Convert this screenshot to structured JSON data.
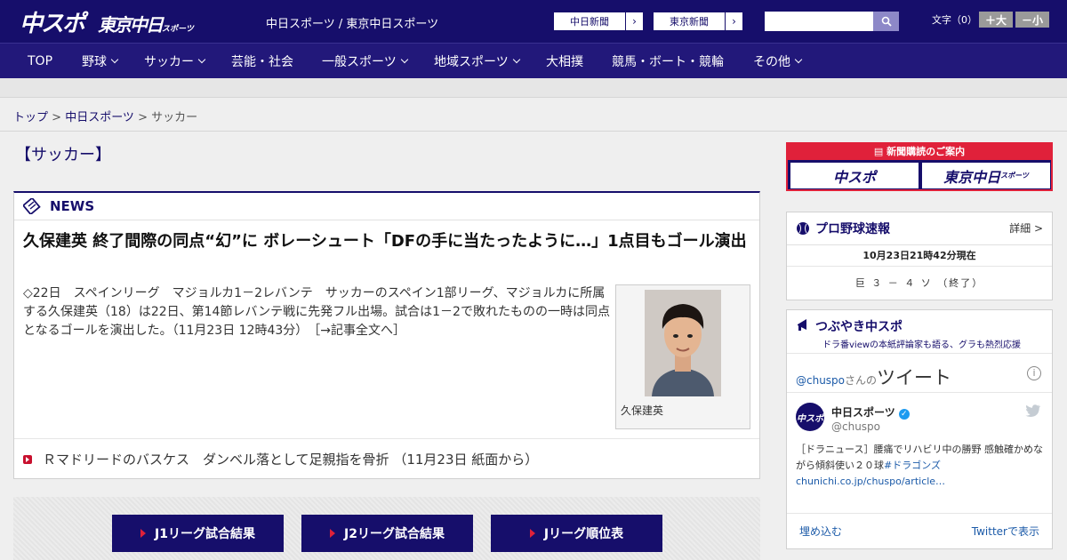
{
  "header": {
    "logo_main": "中スポ",
    "logo_sub": "東京中日",
    "logo_sub_small": "スポーツ",
    "site_title": "中日スポーツ / 東京中日スポーツ",
    "links": [
      {
        "label": "中日新聞",
        "arrow": "›"
      },
      {
        "label": "東京新聞",
        "arrow": "›"
      }
    ],
    "search": {
      "value": "",
      "placeholder": ""
    },
    "font_size_label": "文字（0）",
    "font_up": "＋大",
    "font_down": "－小"
  },
  "nav": {
    "items": [
      {
        "label": "TOP",
        "dropdown": false
      },
      {
        "label": "野球",
        "dropdown": true
      },
      {
        "label": "サッカー",
        "dropdown": true
      },
      {
        "label": "芸能・社会",
        "dropdown": false
      },
      {
        "label": "一般スポーツ",
        "dropdown": true
      },
      {
        "label": "地域スポーツ",
        "dropdown": true
      },
      {
        "label": "大相撲",
        "dropdown": false
      },
      {
        "label": "競馬・ボート・競輪",
        "dropdown": false
      },
      {
        "label": "その他",
        "dropdown": true
      }
    ]
  },
  "breadcrumb": {
    "home": "トップ",
    "sep": " > ",
    "level1": "中日スポーツ",
    "current": "サッカー"
  },
  "section_title": "【サッカー】",
  "news": {
    "label": "NEWS",
    "title": "久保建英 終了間際の同点“幻”に ボレーシュート「DFの手に当たったように…」1点目もゴール演出",
    "body": "◇22日　スペインリーグ　マジョルカ1－2レバンテ　サッカーのスペイン1部リーグ、マジョルカに所属する久保建英（18）は22日、第14節レバンテ戦に先発フル出場。試合は1－2で敗れたものの一時は同点となるゴールを演出した。（11月23日 12時43分）",
    "more_link": "［→記事全文へ］",
    "photo_caption": "久保建英",
    "sub_item": "Ｒマドリードのバスケス　ダンベル落として足親指を骨折 （11月23日 紙面から）"
  },
  "results_buttons": [
    "J1リーグ試合結果",
    "J2リーグ試合結果",
    "Jリーグ順位表"
  ],
  "subscription": {
    "top": "新聞購読のご案内",
    "left": "中スポ",
    "right": "東京中日",
    "right_small": "スポーツ"
  },
  "baseball": {
    "label": "プロ野球速報",
    "more": "詳細 >",
    "time": "10月23日21時42分現在",
    "score": "巨 ３ － ４ ソ （終了）"
  },
  "tweets": {
    "label": "つぶやき中スポ",
    "sub": "ドラ番viewの本紙評論家も語る、グラも熱烈応援",
    "handle_prefix": "@chuspo",
    "handle_suffix": "さんの",
    "heading": "ツイート",
    "info": "i",
    "name": "中日スポーツ",
    "verified": "✓",
    "user_handle": "@chuspo",
    "avatar": "中スポ",
    "text": "［ドラニュース］腰痛でリハビリ中の勝野 感触確かめながら傾斜使い２０球",
    "tag": "#ドラゴンズ",
    "link": "chunichi.co.jp/chuspo/article…",
    "embed": "埋め込む",
    "view": "Twitterで表示"
  },
  "colors": {
    "brand": "#160e6b",
    "accent": "#e0213a"
  }
}
